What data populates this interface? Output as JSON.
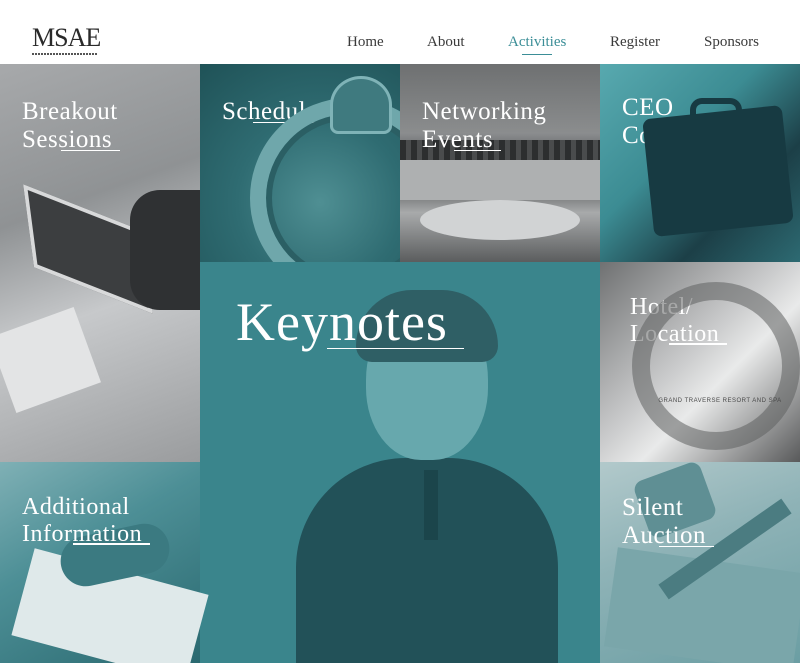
{
  "brand": {
    "logo_text": "MSAE"
  },
  "nav": {
    "items": [
      {
        "label": "Home"
      },
      {
        "label": "About"
      },
      {
        "label": "Activities"
      },
      {
        "label": "Register"
      },
      {
        "label": "Sponsors"
      }
    ],
    "active": "Activities"
  },
  "tiles": {
    "breakout": {
      "line1": "Breakout",
      "line2": "Sessions"
    },
    "schedule": {
      "line1": "",
      "line2": "Schedule"
    },
    "networking": {
      "line1": "Networking",
      "line2": "Events"
    },
    "ceo": {
      "line1": "CEO",
      "line2": "Conference"
    },
    "keynotes": {
      "line1": "",
      "line2": "Keynotes"
    },
    "hotel": {
      "line1": "Hotel/",
      "line2": "Location",
      "sign_text": "GRAND TRAVERSE RESORT AND SPA"
    },
    "additional": {
      "line1": "Additional",
      "line2": "Information"
    },
    "silent": {
      "line1": "Silent",
      "line2": "Auction"
    }
  },
  "colors": {
    "accent": "#3b8e97",
    "teal_dark": "#225158",
    "teal_mid": "#3a858c",
    "nav_text": "#3a3a3a"
  },
  "icons": {
    "logo": "msae-logo"
  }
}
